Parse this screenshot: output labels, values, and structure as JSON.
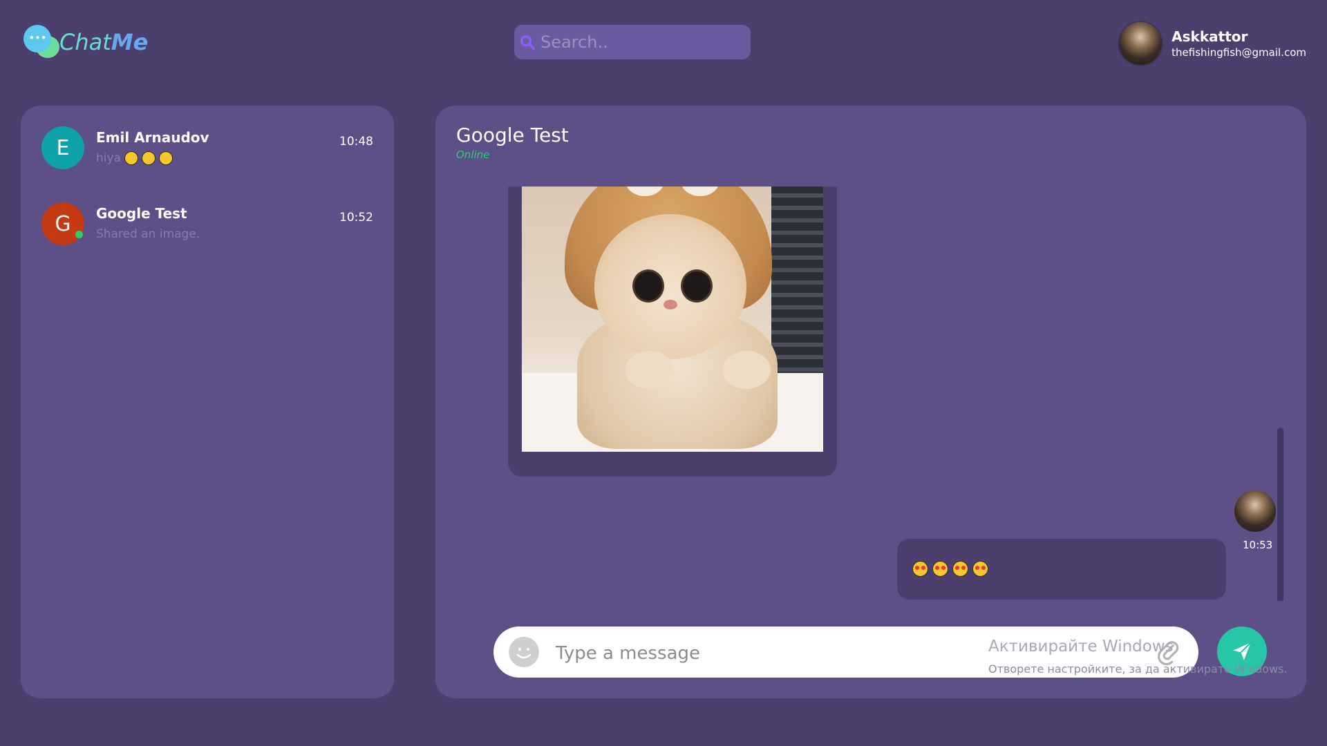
{
  "app": {
    "name_part1": "Chat",
    "name_part2": "Me",
    "logo_dots": "•••"
  },
  "search": {
    "placeholder": "Search.."
  },
  "user": {
    "name": "Askkattor",
    "email": "thefishingfish@gmail.com"
  },
  "chats": [
    {
      "initial": "E",
      "name": "Emil Arnaudov",
      "preview": "hiya",
      "time": "10:48",
      "avatar_color": "#0fa2a8",
      "online": false
    },
    {
      "initial": "G",
      "name": "Google Test",
      "preview": "Shared an image.",
      "time": "10:52",
      "avatar_color": "#c33a13",
      "online": true
    }
  ],
  "conversation": {
    "title": "Google Test",
    "status": "Online",
    "status_color": "#2ecc71",
    "messages": [
      {
        "type": "image",
        "content": "cat photo"
      },
      {
        "type": "text",
        "emoji": "heart-eyes ×4",
        "time": "10:53"
      }
    ]
  },
  "composer": {
    "placeholder": "Type a message"
  },
  "watermark": {
    "line1": "Активирайте Windows",
    "line2": "Отворете настройките, за да активирате Windows."
  },
  "colors": {
    "background": "#4b3f6e",
    "panel": "#5c5087",
    "accent": "#26c6a7"
  }
}
